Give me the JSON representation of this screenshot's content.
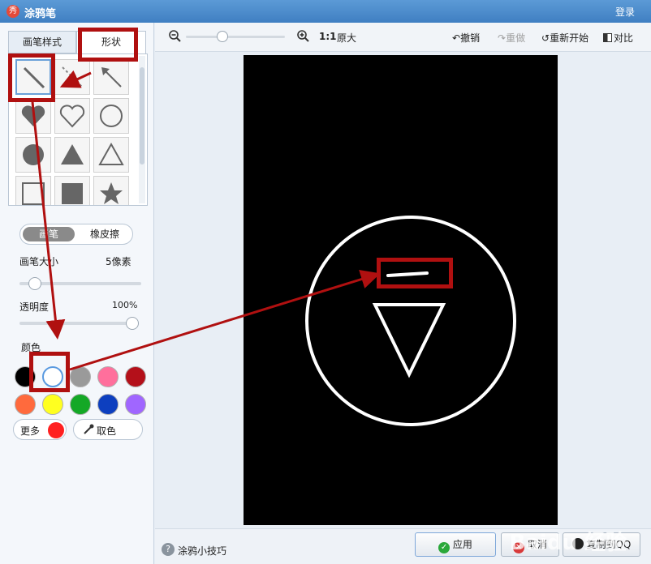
{
  "titlebar": {
    "logo_text": "秀",
    "title": "涂鸦笔",
    "login": "登录"
  },
  "tabs": [
    {
      "label": "画笔样式"
    },
    {
      "label": "形状"
    }
  ],
  "shapes": [
    "line-icon",
    "dashed-line-icon",
    "arrow-icon",
    "heart-filled-icon",
    "heart-outline-icon",
    "circle-outline-icon",
    "circle-filled-icon",
    "triangle-filled-icon",
    "triangle-outline-icon",
    "square-outline-icon",
    "square-filled-icon",
    "star-icon"
  ],
  "toggle": {
    "brush": "画笔",
    "eraser": "橡皮擦"
  },
  "brush_size": {
    "label": "画笔大小",
    "value": "5像素",
    "level": 0.08
  },
  "opacity": {
    "label": "透明度",
    "value": "100%",
    "level": 1.0
  },
  "colors": {
    "label": "颜色",
    "swatches": [
      "#000000",
      "#ffffff",
      "#9a9a9a",
      "#ff6f9c",
      "#b4101a",
      "#ff6a3d",
      "#ffff20",
      "#14a826",
      "#0d3fbf",
      "#a066ff"
    ],
    "selected": "#ffffff",
    "more_label": "更多",
    "more_color": "#ff2020",
    "picker_label": "取色"
  },
  "toolbar": {
    "zoom_level": 0.35,
    "ratio": "1:1",
    "original": "原大",
    "undo": "撤销",
    "redo": "重做",
    "restart": "重新开始",
    "compare": "对比"
  },
  "bottom": {
    "tips": "涂鸦小技巧",
    "apply": "应用",
    "cancel": "取消",
    "copy_qq": "复制到QQ"
  },
  "watermark": "Baidu 经验",
  "accent": "#b01010"
}
